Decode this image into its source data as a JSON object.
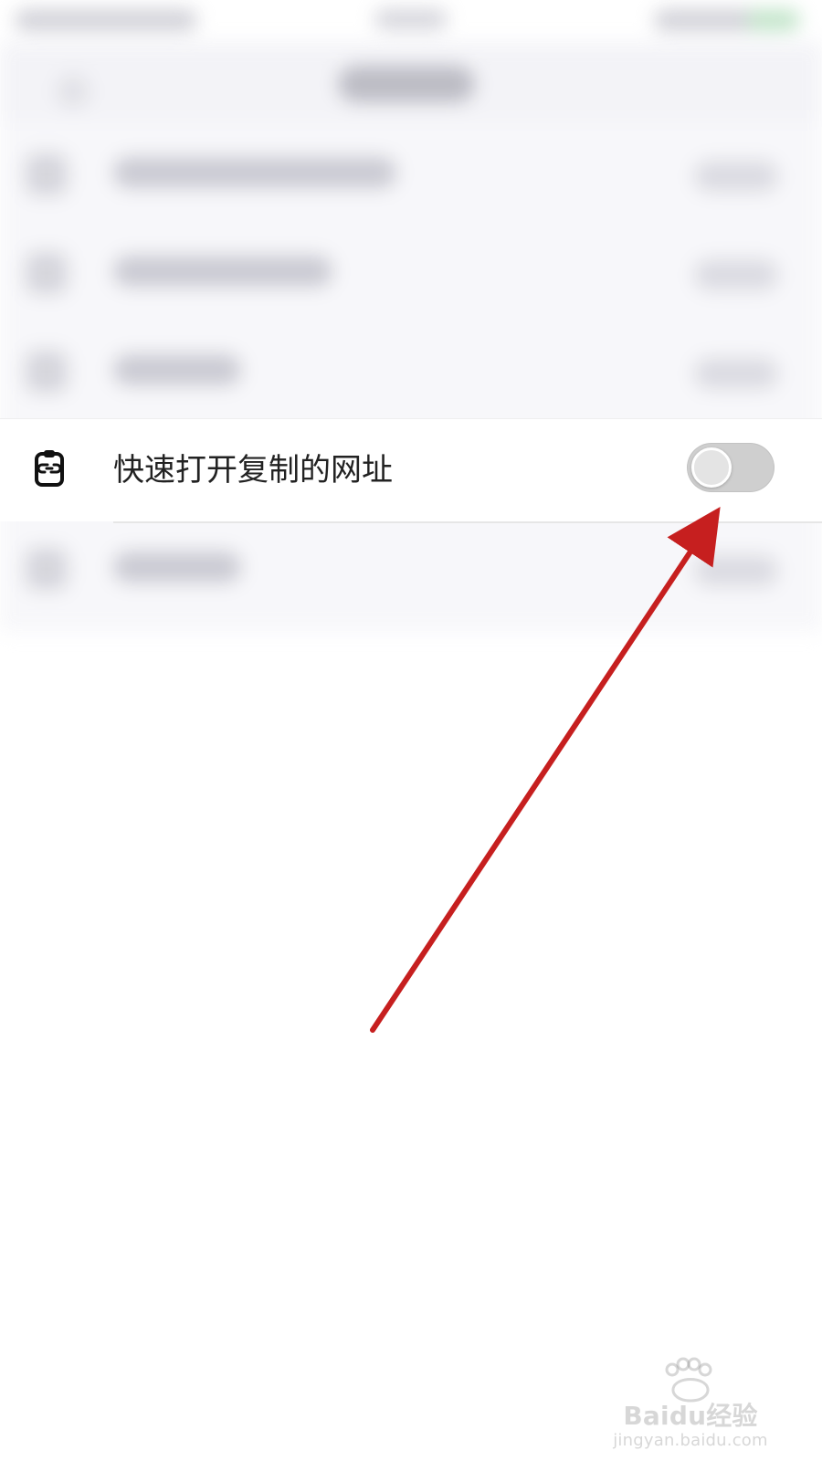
{
  "settings": {
    "row": {
      "icon": "clipboard-link-icon",
      "label": "快速打开复制的网址",
      "toggle_enabled": false
    }
  },
  "overlay": {
    "arrow_color": "#C61F1F"
  },
  "watermark": {
    "brand": "Baidu经验",
    "url": "jingyan.baidu.com"
  }
}
